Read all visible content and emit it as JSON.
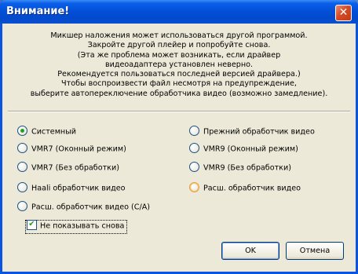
{
  "window": {
    "title": "Внимание!",
    "close_glyph": "✕"
  },
  "message": {
    "lines": [
      "Микшер наложения может использоваться другой программой.",
      "Закройте другой плейер и попробуйте снова.",
      "(Эта же проблема может возникать, если драйвер",
      "видеоадаптера установлен неверно.",
      "Рекомендуется пользоваться последней версией драйвера.)",
      "Чтобы воспроизвести файл несмотря на предупреждение,",
      "выберите автопереключение обработчика видео (возможно замедление)."
    ]
  },
  "options": {
    "left": [
      "Системный",
      "VMR7 (Оконный режим)",
      "VMR7 (Без обработки)",
      "Haali обработчик видео",
      "Расш. обработчик видео (С/А)"
    ],
    "right": [
      "Прежний обработчик видео",
      "VMR9 (Оконный режим)",
      "VMR9 (Без обработки)",
      "Расш. обработчик видео"
    ],
    "selected": "Системный"
  },
  "dont_show_again": {
    "label": "Не показывать снова",
    "checked": true,
    "check_glyph": "✔"
  },
  "buttons": {
    "ok": "OK",
    "cancel": "Отмена"
  }
}
